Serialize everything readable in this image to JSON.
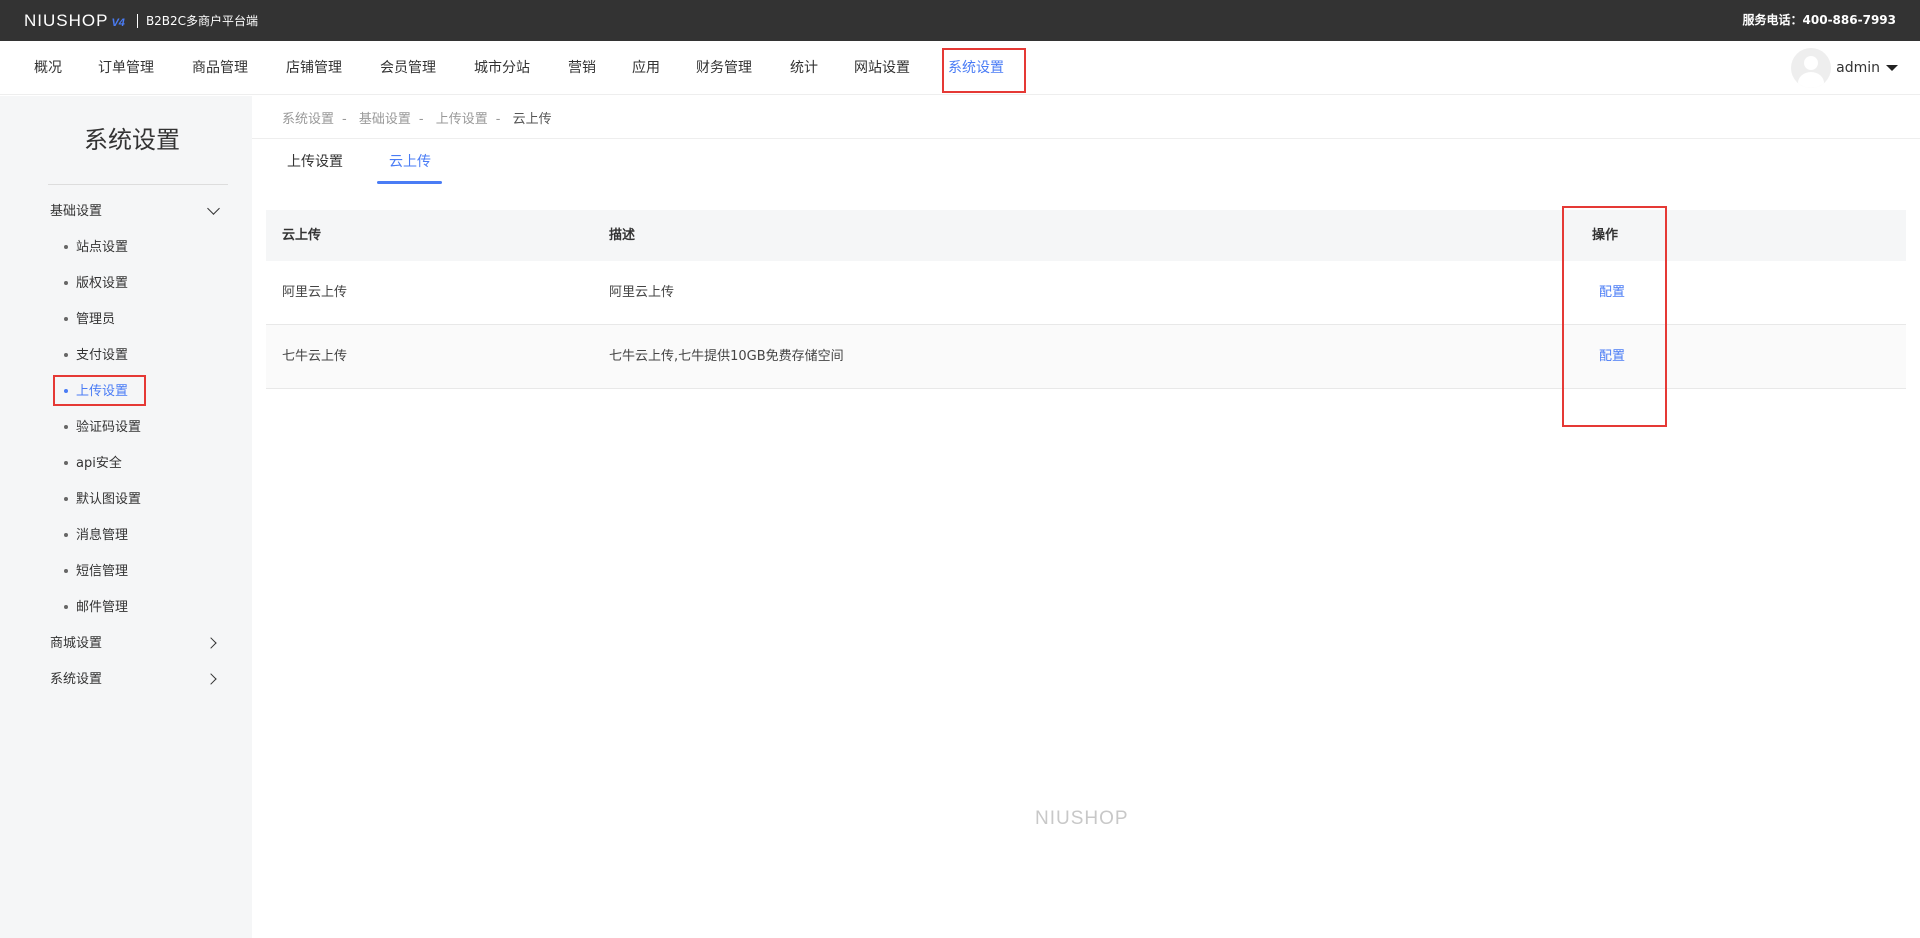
{
  "header": {
    "logo": "NIUSHOP",
    "logo_version": "V4",
    "subtitle": "B2B2C多商户平台端",
    "hotline": "服务电话：400-886-7993"
  },
  "nav": {
    "items": [
      "概况",
      "订单管理",
      "商品管理",
      "店铺管理",
      "会员管理",
      "城市分站",
      "营销",
      "应用",
      "财务管理",
      "统计",
      "网站设置",
      "系统设置"
    ],
    "active_index": 11,
    "user_name": "admin"
  },
  "sidebar": {
    "title": "系统设置",
    "groups": [
      {
        "label": "基础设置",
        "expanded": true,
        "items": [
          "站点设置",
          "版权设置",
          "管理员",
          "支付设置",
          "上传设置",
          "验证码设置",
          "api安全",
          "默认图设置",
          "消息管理",
          "短信管理",
          "邮件管理"
        ],
        "active_item": "上传设置"
      },
      {
        "label": "商城设置",
        "expanded": false
      },
      {
        "label": "系统设置",
        "expanded": false
      }
    ]
  },
  "breadcrumb": [
    "系统设置",
    "基础设置",
    "上传设置",
    "云上传"
  ],
  "breadcrumb_sep": "-",
  "tabs": [
    "上传设置",
    "云上传"
  ],
  "active_tab": "云上传",
  "table": {
    "headers": [
      "云上传",
      "描述",
      "操作"
    ],
    "rows": [
      {
        "name": "阿里云上传",
        "desc": "阿里云上传",
        "action": "配置"
      },
      {
        "name": "七牛云上传",
        "desc": "七牛云上传,七牛提供10GB免费存储空间",
        "action": "配置"
      }
    ]
  },
  "footer_logo": "NIUSHOP",
  "colors": {
    "accent": "#4a7cf5",
    "topbar": "#333333",
    "highlight_box": "#e53935",
    "sidebar_bg": "#f5f6f7"
  }
}
